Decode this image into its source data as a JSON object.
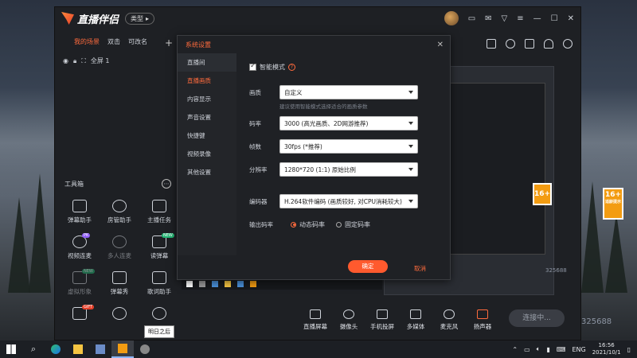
{
  "app": {
    "logo_text": "直播伴侣",
    "type_label": "类型"
  },
  "scene_tabs": [
    "我的场景",
    "双击",
    "可改名"
  ],
  "source": {
    "label": "全屏 1"
  },
  "tools": {
    "title": "工具箱",
    "items": [
      {
        "label": "弹幕助手",
        "badge": ""
      },
      {
        "label": "房管助手",
        "badge": ""
      },
      {
        "label": "主播任务",
        "badge": ""
      },
      {
        "label": "视频连麦",
        "badge": "PK"
      },
      {
        "label": "多人连麦",
        "badge": ""
      },
      {
        "label": "读弹幕",
        "badge": "NEW"
      },
      {
        "label": "虚拟形象",
        "badge": "NEW"
      },
      {
        "label": "弹幕秀",
        "badge": ""
      },
      {
        "label": "歌词助手",
        "badge": ""
      },
      {
        "label": "",
        "badge": "GIFT"
      },
      {
        "label": "",
        "badge": ""
      },
      {
        "label": "",
        "badge": ""
      }
    ]
  },
  "bottom_tools": [
    "直播屏幕",
    "摄像头",
    "手机投屏",
    "多媒体",
    "麦克风",
    "扬声器"
  ],
  "live_button": "连接中...",
  "dialog": {
    "title": "系统设置",
    "nav": [
      "直播间",
      "直播画质",
      "内容显示",
      "声音设置",
      "快捷键",
      "视频录像",
      "其他设置"
    ],
    "active_nav": 1,
    "smart_mode_label": "智能模式",
    "rows": {
      "quality": {
        "label": "画质",
        "value": "自定义"
      },
      "hint": "建议使用智能模式选择适合的画质参数",
      "bitrate": {
        "label": "码率",
        "value": "3000 (高光画质、2D网游推荐)"
      },
      "fps": {
        "label": "帧数",
        "value": "30fps (*推荐)"
      },
      "resolution": {
        "label": "分辨率",
        "value": "1280*720 (1:1) 原始比例"
      },
      "encoder": {
        "label": "编码器",
        "value": "H.264软件编码 (画质较好, 对CPU消耗较大)"
      },
      "rate_mode": {
        "label": "输出码率",
        "opt1": "动态码率",
        "opt2": "固定码率"
      }
    },
    "ok": "确定",
    "cancel": "取消"
  },
  "preview": {
    "number": "325688",
    "small_number": "325688",
    "age_badge": "16+",
    "age_caption": "适龄提示"
  },
  "tooltip": "明日之后",
  "taskbar": {
    "lang": "ENG",
    "time": "16:56",
    "date": "2021/10/1"
  },
  "colors": {
    "accent": "#ff6b3d",
    "ok_button": "#ff5a2e"
  }
}
